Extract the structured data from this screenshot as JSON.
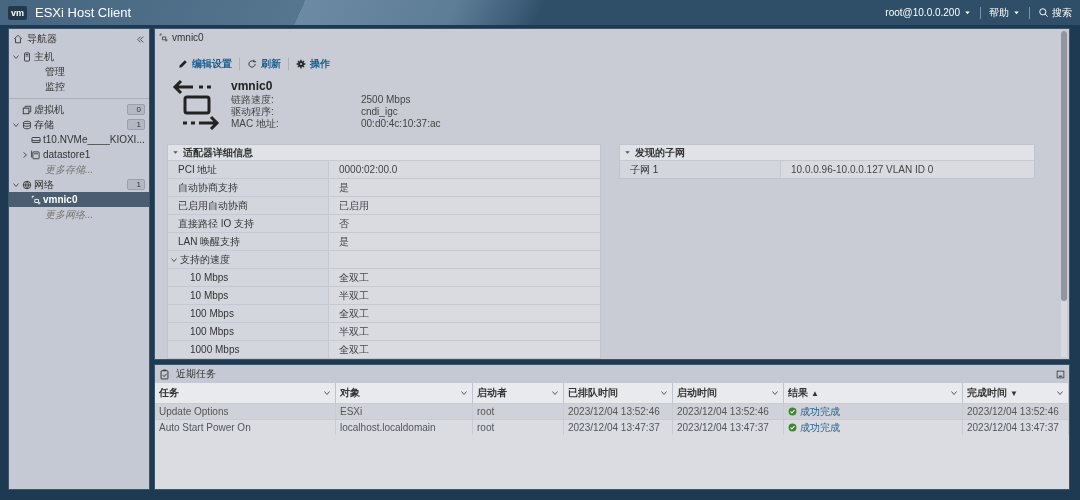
{
  "header": {
    "logo": "vm",
    "title": "ESXi Host Client",
    "user": "root@10.0.0.200",
    "help": "帮助",
    "search": "搜索"
  },
  "navigator": {
    "title": "导航器",
    "items": [
      {
        "label": "主机",
        "expanded": true,
        "selected": false,
        "children": [
          {
            "label": "管理",
            "selected": false
          },
          {
            "label": "监控",
            "selected": false
          }
        ]
      },
      {
        "label": "虚拟机",
        "count": "0",
        "selected": false
      },
      {
        "label": "存储",
        "expanded": true,
        "count": "1",
        "selected": false,
        "children": [
          {
            "label": "t10.NVMe____KIOXI...",
            "selected": false
          },
          {
            "label": "datastore1",
            "expanded": false,
            "selected": false
          },
          {
            "label": "更多存储...",
            "kind": "more",
            "selected": false
          }
        ]
      },
      {
        "label": "网络",
        "expanded": true,
        "count": "1",
        "selected": false,
        "children": [
          {
            "label": "vmnic0",
            "selected": true
          },
          {
            "label": "更多网络...",
            "kind": "more",
            "selected": false
          }
        ]
      }
    ]
  },
  "main": {
    "tab_title": "vmnic0",
    "toolbar": [
      {
        "label": "编辑设置"
      },
      {
        "label": "刷新"
      },
      {
        "label": "操作"
      }
    ],
    "summary": {
      "name": "vmnic0",
      "fields": [
        {
          "label": "链路速度:",
          "value": "2500 Mbps"
        },
        {
          "label": "驱动程序:",
          "value": "cndi_igc"
        },
        {
          "label": "MAC 地址:",
          "value": "00:d0:4c:10:37:ac"
        }
      ]
    },
    "adapter_details": {
      "title": "适配器详细信息",
      "expanded": true,
      "rows": [
        {
          "label": "PCI 地址",
          "value": "0000:02:00.0"
        },
        {
          "label": "自动协商支持",
          "value": "是"
        },
        {
          "label": "已启用自动协商",
          "value": "已启用"
        },
        {
          "label": "直接路径 IO 支持",
          "value": "否"
        },
        {
          "label": "LAN 唤醒支持",
          "value": "是"
        },
        {
          "label": "支持的速度",
          "expanded": true,
          "children": [
            {
              "label": "10 Mbps",
              "value": "全双工"
            },
            {
              "label": "10 Mbps",
              "value": "半双工"
            },
            {
              "label": "100 Mbps",
              "value": "全双工"
            },
            {
              "label": "100 Mbps",
              "value": "半双工"
            },
            {
              "label": "1000 Mbps",
              "value": "全双工"
            }
          ]
        }
      ]
    },
    "discovered_subnets": {
      "title": "发现的子网",
      "expanded": true,
      "rows": [
        {
          "label": "子网 1",
          "value": "10.0.0.96-10.0.0.127 VLAN ID 0"
        }
      ]
    }
  },
  "recent_tasks": {
    "title": "近期任务",
    "columns": [
      {
        "label": "任务"
      },
      {
        "label": "对象"
      },
      {
        "label": "启动者"
      },
      {
        "label": "已排队时间"
      },
      {
        "label": "启动时间"
      },
      {
        "label": "结果",
        "sort_indicator": "▲"
      },
      {
        "label": "完成时间",
        "sort_indicator": "▼"
      }
    ],
    "rows": [
      {
        "cells": [
          "Update Options",
          "ESXi",
          "root",
          "2023/12/04 13:52:46",
          "2023/12/04 13:52:46",
          "成功完成",
          "2023/12/04 13:52:46"
        ]
      },
      {
        "cells": [
          "Auto Start Power On",
          "localhost.localdomain",
          "root",
          "2023/12/04 13:47:37",
          "2023/12/04 13:47:37",
          "成功完成",
          "2023/12/04 13:47:37"
        ]
      }
    ]
  }
}
